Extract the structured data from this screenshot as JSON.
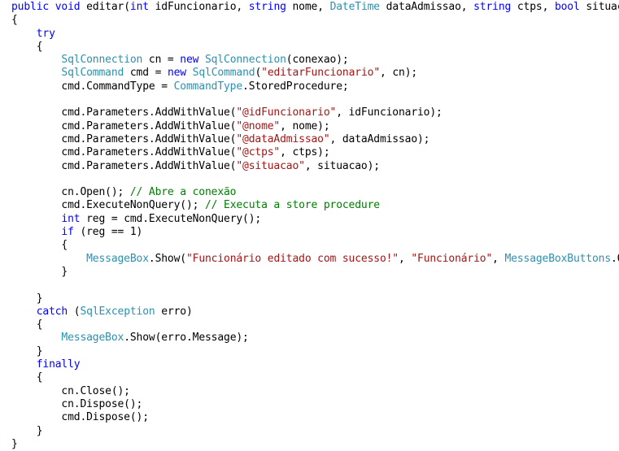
{
  "editor": {
    "language": "csharp",
    "background_color": "#ffffff",
    "foreground_color": "#000000",
    "token_colors": {
      "keyword": "#0000FF",
      "type": "#2B91AF",
      "string": "#A31515",
      "comment": "#008000",
      "plain": "#000000"
    }
  },
  "code": {
    "lines": [
      [
        {
          "t": "kw",
          "s": "public"
        },
        {
          "t": "plain",
          "s": " "
        },
        {
          "t": "kw",
          "s": "void"
        },
        {
          "t": "plain",
          "s": " editar("
        },
        {
          "t": "kw",
          "s": "int"
        },
        {
          "t": "plain",
          "s": " idFuncionario, "
        },
        {
          "t": "kw",
          "s": "string"
        },
        {
          "t": "plain",
          "s": " nome, "
        },
        {
          "t": "type",
          "s": "DateTime"
        },
        {
          "t": "plain",
          "s": " dataAdmissao, "
        },
        {
          "t": "kw",
          "s": "string"
        },
        {
          "t": "plain",
          "s": " ctps, "
        },
        {
          "t": "kw",
          "s": "bool"
        },
        {
          "t": "plain",
          "s": " situacao)"
        }
      ],
      [
        {
          "t": "plain",
          "s": "{"
        }
      ],
      [
        {
          "t": "plain",
          "s": "    "
        },
        {
          "t": "kw",
          "s": "try"
        }
      ],
      [
        {
          "t": "plain",
          "s": "    {"
        }
      ],
      [
        {
          "t": "plain",
          "s": "        "
        },
        {
          "t": "type",
          "s": "SqlConnection"
        },
        {
          "t": "plain",
          "s": " cn = "
        },
        {
          "t": "kw",
          "s": "new"
        },
        {
          "t": "plain",
          "s": " "
        },
        {
          "t": "type",
          "s": "SqlConnection"
        },
        {
          "t": "plain",
          "s": "(conexao);"
        }
      ],
      [
        {
          "t": "plain",
          "s": "        "
        },
        {
          "t": "type",
          "s": "SqlCommand"
        },
        {
          "t": "plain",
          "s": " cmd = "
        },
        {
          "t": "kw",
          "s": "new"
        },
        {
          "t": "plain",
          "s": " "
        },
        {
          "t": "type",
          "s": "SqlCommand"
        },
        {
          "t": "plain",
          "s": "("
        },
        {
          "t": "str",
          "s": "\"editarFuncionario\""
        },
        {
          "t": "plain",
          "s": ", cn);"
        }
      ],
      [
        {
          "t": "plain",
          "s": "        cmd.CommandType = "
        },
        {
          "t": "type",
          "s": "CommandType"
        },
        {
          "t": "plain",
          "s": ".StoredProcedure;"
        }
      ],
      [
        {
          "t": "plain",
          "s": ""
        }
      ],
      [
        {
          "t": "plain",
          "s": "        cmd.Parameters.AddWithValue("
        },
        {
          "t": "str",
          "s": "\"@idFuncionario\""
        },
        {
          "t": "plain",
          "s": ", idFuncionario);"
        }
      ],
      [
        {
          "t": "plain",
          "s": "        cmd.Parameters.AddWithValue("
        },
        {
          "t": "str",
          "s": "\"@nome\""
        },
        {
          "t": "plain",
          "s": ", nome);"
        }
      ],
      [
        {
          "t": "plain",
          "s": "        cmd.Parameters.AddWithValue("
        },
        {
          "t": "str",
          "s": "\"@dataAdmissao\""
        },
        {
          "t": "plain",
          "s": ", dataAdmissao);"
        }
      ],
      [
        {
          "t": "plain",
          "s": "        cmd.Parameters.AddWithValue("
        },
        {
          "t": "str",
          "s": "\"@ctps\""
        },
        {
          "t": "plain",
          "s": ", ctps);"
        }
      ],
      [
        {
          "t": "plain",
          "s": "        cmd.Parameters.AddWithValue("
        },
        {
          "t": "str",
          "s": "\"@situacao\""
        },
        {
          "t": "plain",
          "s": ", situacao);"
        }
      ],
      [
        {
          "t": "plain",
          "s": ""
        }
      ],
      [
        {
          "t": "plain",
          "s": "        cn.Open(); "
        },
        {
          "t": "com",
          "s": "// Abre a conexão"
        }
      ],
      [
        {
          "t": "plain",
          "s": "        cmd.ExecuteNonQuery(); "
        },
        {
          "t": "com",
          "s": "// Executa a store procedure"
        }
      ],
      [
        {
          "t": "plain",
          "s": "        "
        },
        {
          "t": "kw",
          "s": "int"
        },
        {
          "t": "plain",
          "s": " reg = cmd.ExecuteNonQuery();"
        }
      ],
      [
        {
          "t": "plain",
          "s": "        "
        },
        {
          "t": "kw",
          "s": "if"
        },
        {
          "t": "plain",
          "s": " (reg == 1)"
        }
      ],
      [
        {
          "t": "plain",
          "s": "        {"
        }
      ],
      [
        {
          "t": "plain",
          "s": "            "
        },
        {
          "t": "type",
          "s": "MessageBox"
        },
        {
          "t": "plain",
          "s": ".Show("
        },
        {
          "t": "str",
          "s": "\"Funcionário editado com sucesso!\""
        },
        {
          "t": "plain",
          "s": ", "
        },
        {
          "t": "str",
          "s": "\"Funcionário\""
        },
        {
          "t": "plain",
          "s": ", "
        },
        {
          "t": "type",
          "s": "MessageBoxButtons"
        },
        {
          "t": "plain",
          "s": ".OK);"
        }
      ],
      [
        {
          "t": "plain",
          "s": "        }"
        }
      ],
      [
        {
          "t": "plain",
          "s": ""
        }
      ],
      [
        {
          "t": "plain",
          "s": "    }"
        }
      ],
      [
        {
          "t": "plain",
          "s": "    "
        },
        {
          "t": "kw",
          "s": "catch"
        },
        {
          "t": "plain",
          "s": " ("
        },
        {
          "t": "type",
          "s": "SqlException"
        },
        {
          "t": "plain",
          "s": " erro)"
        }
      ],
      [
        {
          "t": "plain",
          "s": "    {"
        }
      ],
      [
        {
          "t": "plain",
          "s": "        "
        },
        {
          "t": "type",
          "s": "MessageBox"
        },
        {
          "t": "plain",
          "s": ".Show(erro.Message);"
        }
      ],
      [
        {
          "t": "plain",
          "s": "    }"
        }
      ],
      [
        {
          "t": "plain",
          "s": "    "
        },
        {
          "t": "kw",
          "s": "finally"
        }
      ],
      [
        {
          "t": "plain",
          "s": "    {"
        }
      ],
      [
        {
          "t": "plain",
          "s": "        cn.Close();"
        }
      ],
      [
        {
          "t": "plain",
          "s": "        cn.Dispose();"
        }
      ],
      [
        {
          "t": "plain",
          "s": "        cmd.Dispose();"
        }
      ],
      [
        {
          "t": "plain",
          "s": "    }"
        }
      ],
      [
        {
          "t": "plain",
          "s": "}"
        }
      ]
    ]
  }
}
